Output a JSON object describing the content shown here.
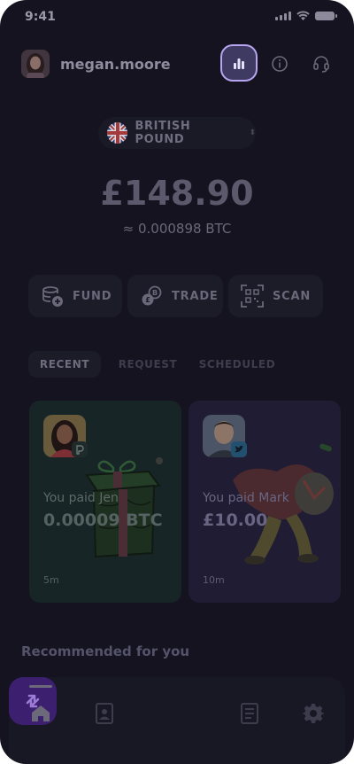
{
  "status_bar": {
    "time": "9:41"
  },
  "header": {
    "username": "megan.moore"
  },
  "currency": {
    "label": "BRITISH POUND"
  },
  "balance": {
    "amount": "£148.90",
    "btc": "≈ 0.000898 BTC"
  },
  "actions": [
    {
      "label": "FUND",
      "icon": "coins-add-icon"
    },
    {
      "label": "TRADE",
      "icon": "coins-exchange-icon"
    },
    {
      "label": "SCAN",
      "icon": "qr-scan-icon"
    }
  ],
  "tabs": [
    {
      "label": "RECENT",
      "active": true
    },
    {
      "label": "REQUEST",
      "active": false
    },
    {
      "label": "SCHEDULED",
      "active": false
    }
  ],
  "activity": [
    {
      "title": "You paid Jen",
      "amount": "0.00009 BTC",
      "time": "5m",
      "color": "#172526"
    },
    {
      "title": "You paid Mark",
      "amount": "£10.00",
      "time": "10m",
      "color": "#1f1c33"
    }
  ],
  "recommended": {
    "title": "Recommended for you"
  },
  "colors": {
    "accent": "#b7a5ef",
    "center_button": "#3c1f6f",
    "background": "#14131f"
  }
}
